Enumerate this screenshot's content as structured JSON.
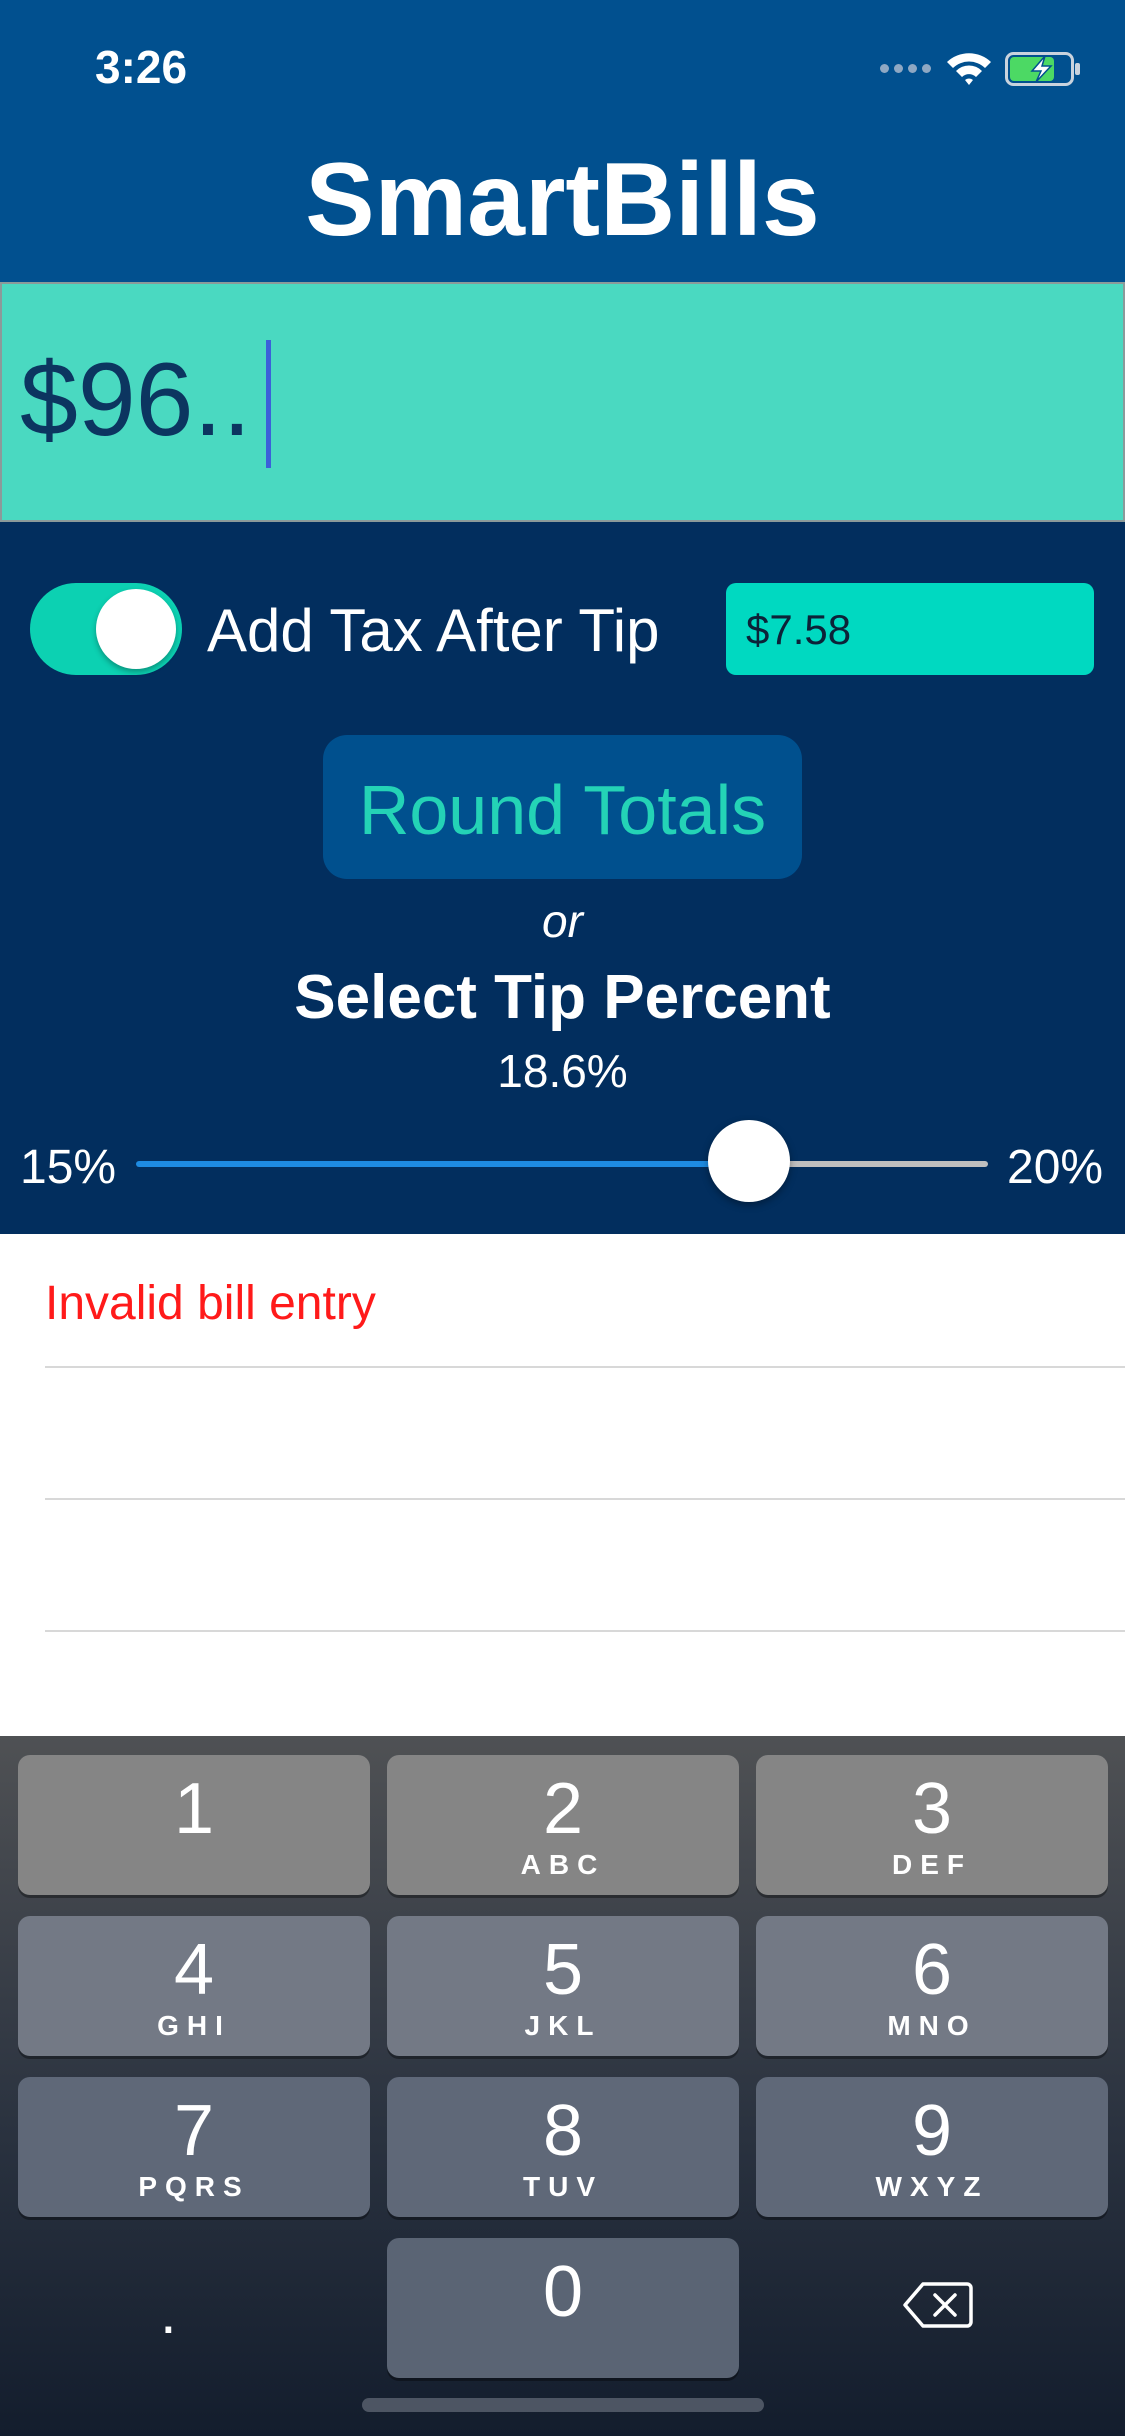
{
  "status_bar": {
    "time": "3:26"
  },
  "app": {
    "title": "SmartBills"
  },
  "bill": {
    "value": "$96.."
  },
  "tax": {
    "label": "Add Tax After Tip",
    "value": "$7.58",
    "toggle_on": true
  },
  "round_button": {
    "label": "Round Totals"
  },
  "tip": {
    "or_text": "or",
    "heading": "Select Tip Percent",
    "value_text": "18.6%",
    "min_label": "15%",
    "max_label": "20%",
    "min": 15,
    "max": 20,
    "value": 18.6
  },
  "results": {
    "error": "Invalid bill entry"
  },
  "keyboard": {
    "keys": [
      {
        "num": "1",
        "letters": ""
      },
      {
        "num": "2",
        "letters": "ABC"
      },
      {
        "num": "3",
        "letters": "DEF"
      },
      {
        "num": "4",
        "letters": "GHI"
      },
      {
        "num": "5",
        "letters": "JKL"
      },
      {
        "num": "6",
        "letters": "MNO"
      },
      {
        "num": "7",
        "letters": "PQRS"
      },
      {
        "num": "8",
        "letters": "TUV"
      },
      {
        "num": "9",
        "letters": "WXYZ"
      }
    ],
    "zero": "0",
    "dot": "."
  },
  "colors": {
    "header": "#01508f",
    "accent": "#00d9c1",
    "panel": "#022e5e",
    "error": "#ff1a1a"
  }
}
